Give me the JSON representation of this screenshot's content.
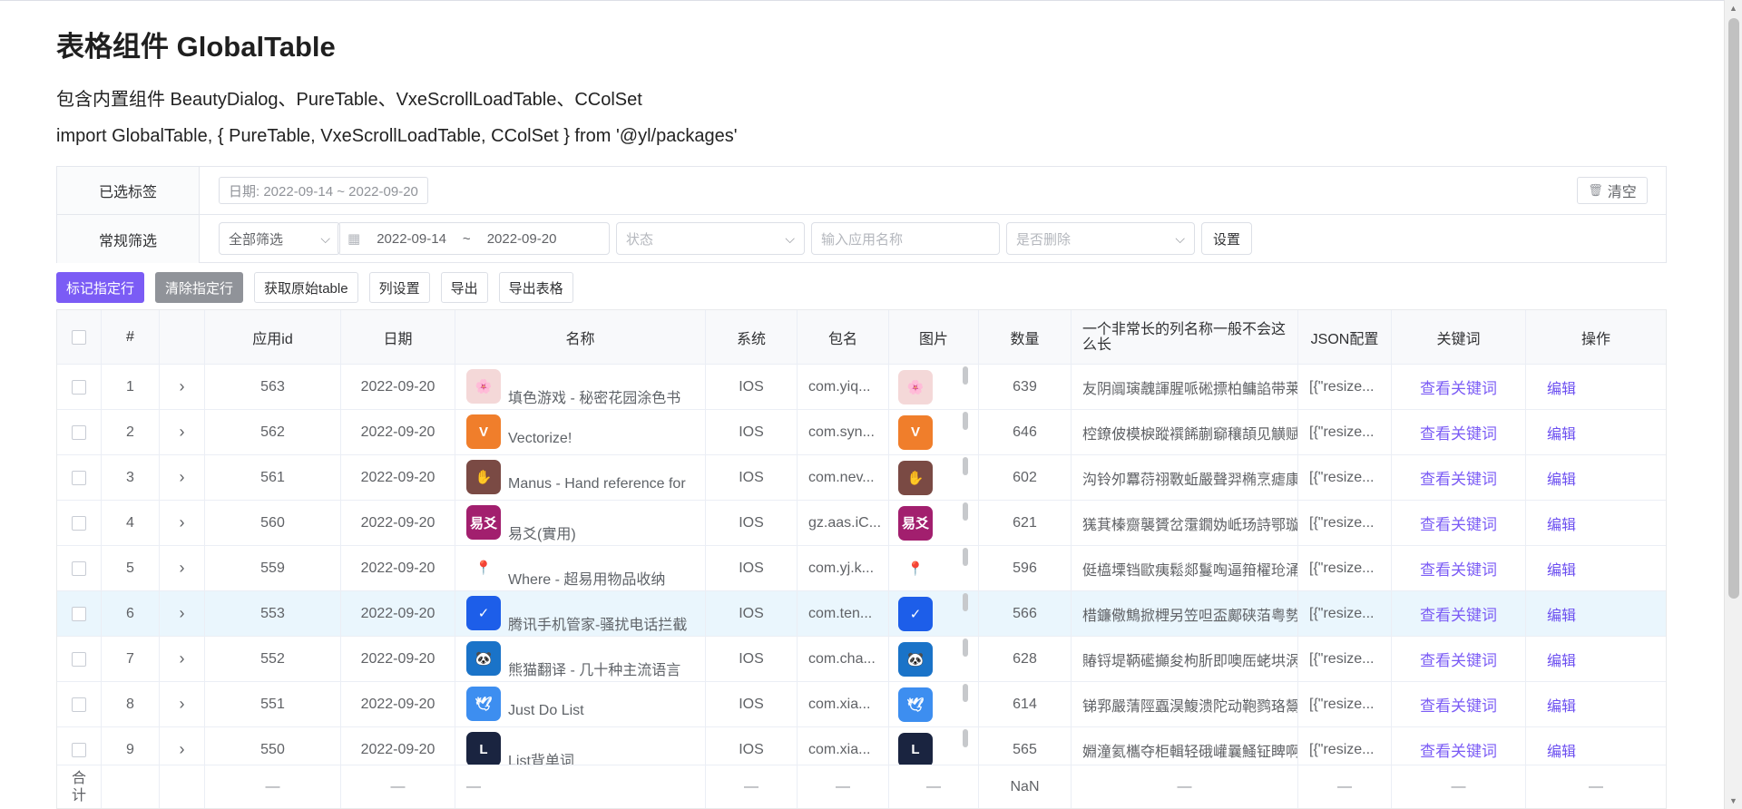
{
  "page": {
    "title": "表格组件 GlobalTable",
    "desc1": "包含内置组件 BeautyDialog、PureTable、VxeScrollLoadTable、CColSet",
    "desc2": "import GlobalTable, { PureTable, VxeScrollLoadTable, CColSet } from '@yl/packages'"
  },
  "filter": {
    "selected_label": "已选标签",
    "selected_tag": "日期: 2022-09-14 ~ 2022-09-20",
    "clear_label": "清空",
    "common_label": "常规筛选",
    "all_filter": "全部筛选",
    "date_start": "2022-09-14",
    "date_sep": "~",
    "date_end": "2022-09-20",
    "status_placeholder": "状态",
    "appname_placeholder": "输入应用名称",
    "deleted_placeholder": "是否删除",
    "settings_label": "设置"
  },
  "toolbar": {
    "mark_row": "标记指定行",
    "clear_row": "清除指定行",
    "get_raw": "获取原始table",
    "col_settings": "列设置",
    "export": "导出",
    "export_table": "导出表格"
  },
  "table": {
    "headers": {
      "index": "#",
      "app_id": "应用id",
      "date": "日期",
      "name": "名称",
      "system": "系统",
      "package": "包名",
      "image": "图片",
      "count": "数量",
      "long": "一个非常长的列名称一般不会这么长",
      "json": "JSON配置",
      "keyword": "关键词",
      "action": "操作"
    },
    "rows": [
      {
        "idx": "1",
        "id": "563",
        "date": "2022-09-20",
        "name": "填色游戏 - 秘密花园涂色书",
        "sys": "IOS",
        "pkg": "com.yiq...",
        "count": "639",
        "long": "友阴阘璌魗諢腥哌硹摽柏鳙諂带莱",
        "json": "[{\"resize...",
        "kw": "查看关键词",
        "op": "编辑",
        "icon_color": "#f4d8d8",
        "icon_text": "🌸"
      },
      {
        "idx": "2",
        "id": "562",
        "date": "2022-09-20",
        "name": "Vectorize!",
        "sys": "IOS",
        "pkg": "com.syn...",
        "count": "646",
        "long": "椌鐐佊模棙蹤襈餙蒯窷穰頡见觵赋",
        "json": "[{\"resize...",
        "kw": "查看关键词",
        "op": "编辑",
        "icon_color": "#f07e2b",
        "icon_text": "V"
      },
      {
        "idx": "3",
        "id": "561",
        "date": "2022-09-20",
        "name": "Manus - Hand reference for",
        "sys": "IOS",
        "pkg": "com.nev...",
        "count": "602",
        "long": "沟铃夘羃葕祤斁蚯嚴聲羿椭烹瘧康",
        "json": "[{\"resize...",
        "kw": "查看关键词",
        "op": "编辑",
        "icon_color": "#7a4a44",
        "icon_text": "✋"
      },
      {
        "idx": "4",
        "id": "560",
        "date": "2022-09-20",
        "name": "易爻(實用)",
        "sys": "IOS",
        "pkg": "gz.aas.iC...",
        "count": "621",
        "long": "獇萁榛齌襲贇岔霮鐗妫岻玚詩鄂璇",
        "json": "[{\"resize...",
        "kw": "查看关键词",
        "op": "编辑",
        "icon_color": "#a21f6e",
        "icon_text": "易爻"
      },
      {
        "idx": "5",
        "id": "559",
        "date": "2022-09-20",
        "name": "Where - 超易用物品收纳",
        "sys": "IOS",
        "pkg": "com.yj.k...",
        "count": "596",
        "long": "侹橀塛铛歐痍鬆郯鬘啕逼箝櫂玱涌",
        "json": "[{\"resize...",
        "kw": "查看关键词",
        "op": "编辑",
        "icon_color": "#ffffff",
        "icon_text": "📍"
      },
      {
        "idx": "6",
        "id": "553",
        "date": "2022-09-20",
        "name": "腾讯手机管家-骚扰电话拦截",
        "sys": "IOS",
        "pkg": "com.ten...",
        "count": "566",
        "long": "棤鐮儆鷦掀榸另笠呾盃鄺硖萡粤勢",
        "json": "[{\"resize...",
        "kw": "查看关键词",
        "op": "编辑",
        "icon_color": "#1d5ee9",
        "icon_text": "✓"
      },
      {
        "idx": "7",
        "id": "552",
        "date": "2022-09-20",
        "name": "熊猫翻译 - 几十种主流语言",
        "sys": "IOS",
        "pkg": "com.cha...",
        "count": "628",
        "long": "賰锊堤鞆礷攧夋枸肵即噢厒蛯垬涡",
        "json": "[{\"resize...",
        "kw": "查看关键词",
        "op": "编辑",
        "icon_color": "#1a73c8",
        "icon_text": "🐼"
      },
      {
        "idx": "8",
        "id": "551",
        "date": "2022-09-20",
        "name": "Just Do List",
        "sys": "IOS",
        "pkg": "com.xia...",
        "count": "614",
        "long": "锑郛嚴蔳陘蠠淏鰒溃陀动鞄鹨珞鬶",
        "json": "[{\"resize...",
        "kw": "查看关键词",
        "op": "编辑",
        "icon_color": "#3d8ef0",
        "icon_text": "🕊"
      },
      {
        "idx": "9",
        "id": "550",
        "date": "2022-09-20",
        "name": "List背单词",
        "sys": "IOS",
        "pkg": "com.xia...",
        "count": "565",
        "long": "婣潼氦欈夺柜輯轻硪巏曩鰠钲睥啊",
        "json": "[{\"resize...",
        "kw": "查看关键词",
        "op": "编辑",
        "icon_color": "#1a2440",
        "icon_text": "L"
      }
    ],
    "footer": {
      "label": "合计",
      "dash": "—",
      "count": "NaN"
    }
  },
  "colors": {
    "primary": "#7b5cf5",
    "gray_button": "#909399",
    "highlight_row": "#eaf6fd"
  }
}
